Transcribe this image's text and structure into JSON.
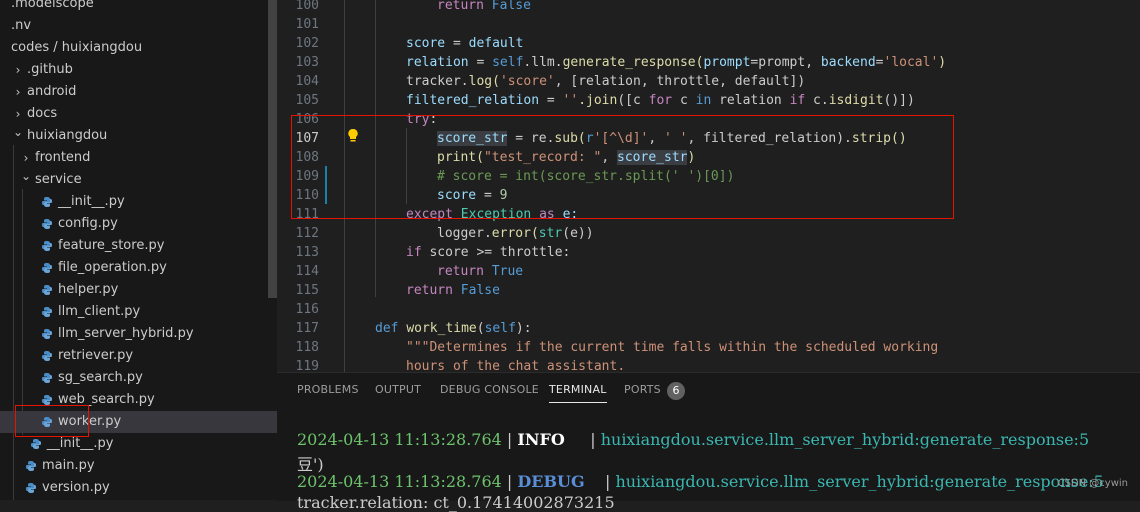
{
  "sidebar": {
    "items": [
      {
        "label": ".modelscope",
        "type": "folder",
        "expanded": false
      },
      {
        "label": ".nv",
        "type": "folder",
        "expanded": false
      },
      {
        "label": "codes / huixiangdou",
        "type": "folder",
        "expanded": true
      },
      {
        "label": ".github",
        "type": "folder",
        "expanded": false
      },
      {
        "label": "android",
        "type": "folder",
        "expanded": false
      },
      {
        "label": "docs",
        "type": "folder",
        "expanded": false
      },
      {
        "label": "huixiangdou",
        "type": "folder",
        "expanded": true
      },
      {
        "label": "frontend",
        "type": "folder",
        "expanded": false
      },
      {
        "label": "service",
        "type": "folder",
        "expanded": true
      },
      {
        "label": "__init__.py",
        "type": "python-file"
      },
      {
        "label": "config.py",
        "type": "python-file"
      },
      {
        "label": "feature_store.py",
        "type": "python-file"
      },
      {
        "label": "file_operation.py",
        "type": "python-file"
      },
      {
        "label": "helper.py",
        "type": "python-file"
      },
      {
        "label": "llm_client.py",
        "type": "python-file"
      },
      {
        "label": "llm_server_hybrid.py",
        "type": "python-file"
      },
      {
        "label": "retriever.py",
        "type": "python-file"
      },
      {
        "label": "sg_search.py",
        "type": "python-file"
      },
      {
        "label": "web_search.py",
        "type": "python-file"
      },
      {
        "label": "worker.py",
        "type": "python-file",
        "selected": true
      },
      {
        "label": "__init__.py",
        "type": "python-file"
      },
      {
        "label": "main.py",
        "type": "python-file"
      },
      {
        "label": "version.py",
        "type": "python-file"
      }
    ]
  },
  "editor": {
    "line_numbers": [
      "100",
      "101",
      "102",
      "103",
      "104",
      "105",
      "106",
      "107",
      "108",
      "109",
      "110",
      "111",
      "112",
      "113",
      "114",
      "115",
      "116",
      "117",
      "118",
      "119"
    ],
    "active_line": "107",
    "code": {
      "l100_return": "return",
      "l100_false": "False",
      "l102_score": "score",
      "l102_eq": " = ",
      "l102_default": "default",
      "l103_relation": "relation",
      "l103_eq": " = ",
      "l103_self": "self",
      "l103_mid": ".llm.",
      "l103_fn": "generate_response",
      "l103_p1": "(",
      "l103_prompt": "prompt",
      "l103_eq2": "=prompt, ",
      "l103_backend": "backend",
      "l103_eq3": "=",
      "l103_local": "'local'",
      "l103_close": ")",
      "l104_tracker": "tracker.",
      "l104_log": "log",
      "l104_open": "(",
      "l104_score": "'score'",
      "l104_rest": ", [relation, throttle, default])",
      "l105_fr": "filtered_relation",
      "l105_eq": " = ",
      "l105_str": "''",
      "l105_join": ".join",
      "l105_a": "([c ",
      "l105_for": "for",
      "l105_b": " c ",
      "l105_in": "in",
      "l105_c": " relation ",
      "l105_if": "if",
      "l105_d": " c.",
      "l105_isdigit": "isdigit",
      "l105_e": "()])",
      "l106_try": "try",
      "l106_colon": ":",
      "l107_var": "score_str",
      "l107_eq": " = re.",
      "l107_sub": "sub",
      "l107_open": "(",
      "l107_r": "r",
      "l107_pat": "'[^\\d]'",
      "l107_comma": ", ",
      "l107_sp": "' '",
      "l107_rest": ", filtered_relation).",
      "l107_strip": "strip",
      "l107_end": "()",
      "l108_print": "print",
      "l108_open": "(",
      "l108_str": "\"test_record: \"",
      "l108_comma": ", ",
      "l108_var": "score_str",
      "l108_close": ")",
      "l109_comment": "# score = int(score_str.split(' ')[0])",
      "l110_score": "score",
      "l110_eq": " = ",
      "l110_num": "9",
      "l111_except": "except",
      "l111_exc": "Exception",
      "l111_as": "as",
      "l111_e": "e:",
      "l112_logger": "logger.",
      "l112_error": "error",
      "l112_open": "(",
      "l112_str": "str",
      "l112_rest": "(e))",
      "l113_if": "if",
      "l113_rest": " score >= throttle:",
      "l114_return": "return",
      "l114_true": "True",
      "l115_return": "return",
      "l115_false": "False",
      "l117_def": "def",
      "l117_fn": "work_time",
      "l117_open": "(",
      "l117_self": "self",
      "l117_close": "):",
      "l118_doc": "\"\"\"Determines if the current time falls within the scheduled working",
      "l119_doc": "hours of the chat assistant."
    }
  },
  "panel": {
    "tabs": [
      {
        "label": "PROBLEMS",
        "active": false
      },
      {
        "label": "OUTPUT",
        "active": false
      },
      {
        "label": "DEBUG CONSOLE",
        "active": false
      },
      {
        "label": "TERMINAL",
        "active": true
      },
      {
        "label": "PORTS",
        "active": false
      }
    ],
    "ports_count": "6",
    "terminal": {
      "line1_time": "2024-04-13 11:13:28.764",
      "line1_sep": " | ",
      "line1_level": "INFO",
      "line1_sep2": "     | ",
      "line1_module": "huixiangdou.service.llm_server_hybrid",
      "line1_rest": ":generate_response:5",
      "line2": "豆')",
      "line3_time": "2024-04-13 11:13:28.764",
      "line3_sep": " | ",
      "line3_level": "DEBUG",
      "line3_sep2": "    | ",
      "line3_module": "huixiangdou.service.llm_server_hybrid",
      "line3_rest": ":generate_response:5",
      "line4": "tracker.relation: ct_0.17414002873215"
    }
  },
  "watermark": "CSDN @cywin",
  "colors": {
    "highlight_box": "#e51400",
    "accent": "#1b81a8"
  }
}
